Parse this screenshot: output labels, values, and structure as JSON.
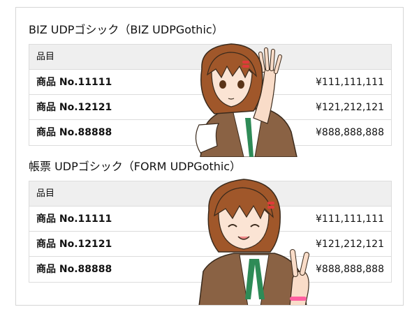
{
  "sections": [
    {
      "title": "BIZ UDPゴシック（BIZ UDPGothic）",
      "header_label": "品目",
      "rows": [
        {
          "name": "商品 No.11111",
          "price": "¥111,111,111"
        },
        {
          "name": "商品 No.12121",
          "price": "¥121,212,121"
        },
        {
          "name": "商品 No.88888",
          "price": "¥888,888,888"
        }
      ]
    },
    {
      "title": "帳票 UDPゴシック（FORM UDPGothic）",
      "header_label": "品目",
      "rows": [
        {
          "name": "商品 No.11111",
          "price": "¥111,111,111"
        },
        {
          "name": "商品 No.12121",
          "price": "¥121,212,121"
        },
        {
          "name": "商品 No.88888",
          "price": "¥888,888,888"
        }
      ]
    }
  ],
  "colors": {
    "hair": "#a0572a",
    "jacket": "#8a6244",
    "ribbon": "#2e8b57",
    "clip": "#e03a3a"
  }
}
